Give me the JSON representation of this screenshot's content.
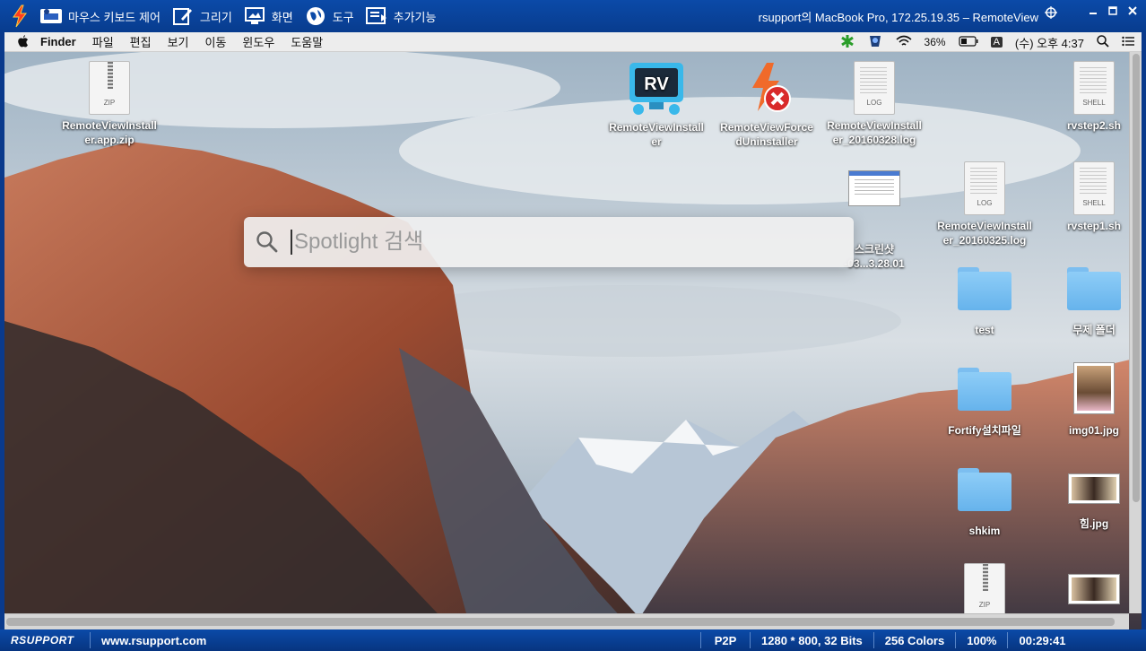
{
  "toolbar": {
    "items": [
      {
        "label": "마우스 키보드 제어",
        "icon": "mouse-keyboard-icon"
      },
      {
        "label": "그리기",
        "icon": "draw-icon"
      },
      {
        "label": "화면",
        "icon": "screen-icon"
      },
      {
        "label": "도구",
        "icon": "tools-globe-icon"
      },
      {
        "label": "추가기능",
        "icon": "extra-functions-icon"
      }
    ],
    "title": "rsupport의 MacBook Pro, 172.25.19.35 – RemoteView"
  },
  "mac_menubar": {
    "app": "Finder",
    "menus": [
      "파일",
      "편집",
      "보기",
      "이동",
      "윈도우",
      "도움말"
    ],
    "battery": "36%",
    "input_source": "A",
    "clock": "(수) 오후 4:37"
  },
  "spotlight": {
    "placeholder": "Spotlight 검색"
  },
  "desktop_icons": [
    {
      "name": "RemoteViewInstall\ner.app.zip",
      "type": "zip"
    },
    {
      "name": "RemoteViewInstall\ner",
      "type": "app-rv"
    },
    {
      "name": "RemoteViewForce\ndUninstaller",
      "type": "app-uninstall"
    },
    {
      "name": "RemoteViewInstall\ner_20160328.log",
      "type": "log"
    },
    {
      "name": "rvstep2.sh",
      "type": "shell"
    },
    {
      "name": "스크린샷\n-03...3.28.01",
      "type": "screenshot"
    },
    {
      "name": "RemoteViewInstall\ner_20160325.log",
      "type": "log"
    },
    {
      "name": "rvstep1.sh",
      "type": "shell"
    },
    {
      "name": "test",
      "type": "folder"
    },
    {
      "name": "무제 폴더",
      "type": "folder"
    },
    {
      "name": "Fortify설치파일",
      "type": "folder"
    },
    {
      "name": "img01.jpg",
      "type": "photo"
    },
    {
      "name": "shkim",
      "type": "folder"
    },
    {
      "name": "힘.jpg",
      "type": "photo-wide"
    },
    {
      "name": "",
      "type": "zip"
    },
    {
      "name": "",
      "type": "photo-wide"
    }
  ],
  "status": {
    "brand": "RSUPPORT",
    "url": "www.rsupport.com",
    "mode": "P2P",
    "resolution": "1280 * 800, 32 Bits",
    "colors": "256 Colors",
    "zoom": "100%",
    "elapsed": "00:29:41"
  },
  "colors": {
    "toolbar_blue": "#0b4aa8",
    "folder_blue": "#7cbef0"
  }
}
